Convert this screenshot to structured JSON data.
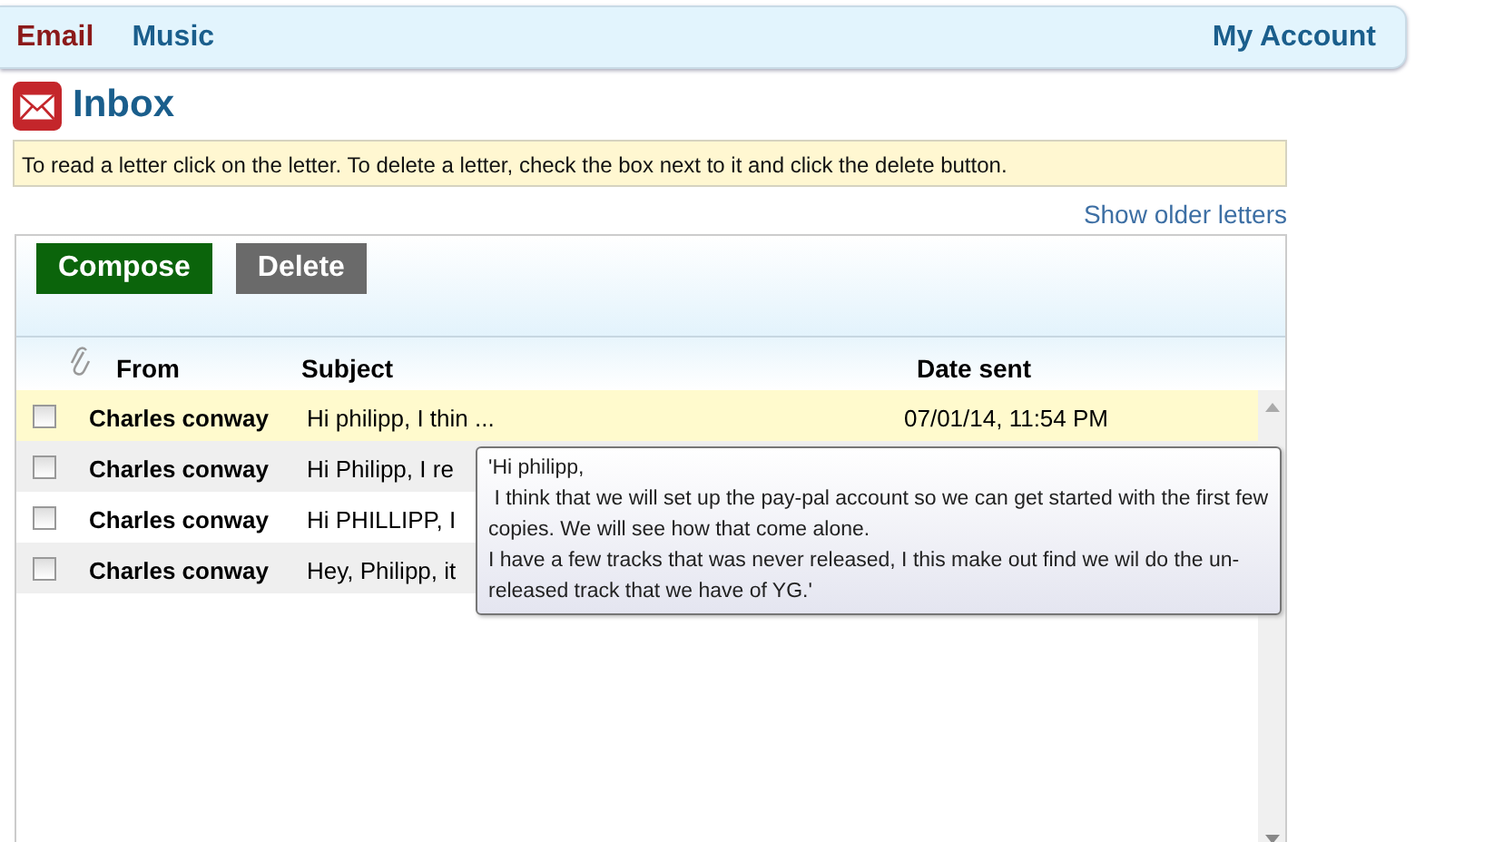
{
  "nav": {
    "tabs": [
      {
        "label": "Email",
        "selected": true
      },
      {
        "label": "Music",
        "selected": false
      }
    ],
    "account": "My Account"
  },
  "title": "Inbox",
  "instructions": "To read a letter click on the letter. To delete a letter, check the box next to it and click the delete button.",
  "older_link": "Show older letters",
  "buttons": [
    {
      "label": "Compose",
      "kind": "primary"
    },
    {
      "label": "Delete",
      "kind": "secondary"
    }
  ],
  "table": {
    "columns": [
      "From",
      "Subject",
      "Date sent"
    ],
    "rows": [
      {
        "from": "Charles conway",
        "subject": "Hi philipp, I thin ...",
        "date": "07/01/14, 11:54 PM",
        "checked": false,
        "highlighted": true
      },
      {
        "from": "Charles conway",
        "subject": "Hi Philipp, I re",
        "checked": false,
        "highlighted": false
      },
      {
        "from": "Charles conway",
        "subject": "Hi PHILLIPP, I",
        "checked": false,
        "highlighted": false
      },
      {
        "from": "Charles conway",
        "subject": "Hey, Philipp, it",
        "checked": false,
        "highlighted": false
      }
    ]
  },
  "tooltip": {
    "lines": [
      "'Hi philipp,",
      " I think that we will set up the pay-pal account so we can get started with the first few",
      "copies. We will see how that come alone.",
      "I have a few tracks that was never released, I this make out find we wil do the un-",
      "released track that we have of YG.'"
    ]
  }
}
